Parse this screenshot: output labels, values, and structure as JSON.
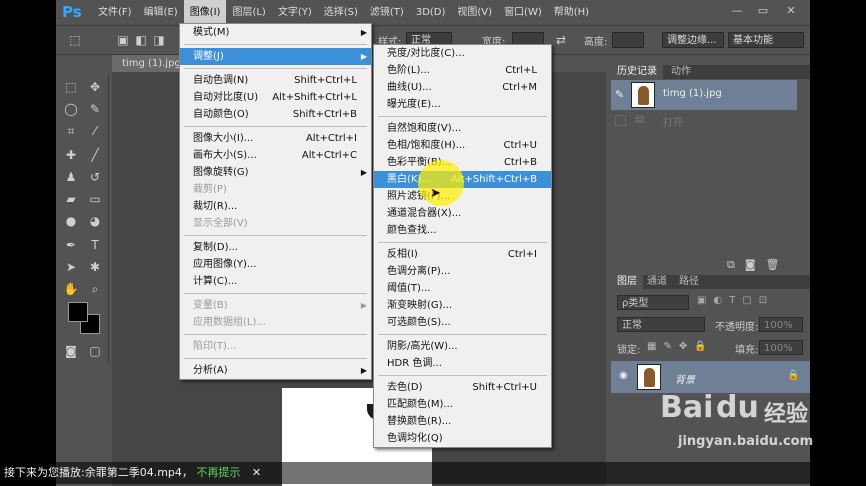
{
  "app": {
    "logo": "Ps"
  },
  "menubar": [
    "文件(F)",
    "编辑(E)",
    "图像(I)",
    "图层(L)",
    "文字(Y)",
    "选择(S)",
    "滤镜(T)",
    "3D(D)",
    "视图(V)",
    "窗口(W)",
    "帮助(H)"
  ],
  "window_controls": {
    "minimize": "—",
    "restore": "▭",
    "close": "✕"
  },
  "options_bar": {
    "style_label": "样式:",
    "style_value": "正常",
    "width_label": "宽度:",
    "height_label": "高度:",
    "refine_button": "调整边缘...",
    "workspace": "基本功能"
  },
  "document_tab": "timg (1).jpg",
  "image_menu": [
    {
      "label": "模式(M)",
      "shortcut": "",
      "submenu": true,
      "disabled": false
    },
    {
      "sep": true
    },
    {
      "label": "调整(J)",
      "shortcut": "",
      "submenu": true,
      "disabled": false,
      "active": true
    },
    {
      "sep": true
    },
    {
      "label": "自动色调(N)",
      "shortcut": "Shift+Ctrl+L",
      "disabled": false
    },
    {
      "label": "自动对比度(U)",
      "shortcut": "Alt+Shift+Ctrl+L",
      "disabled": false
    },
    {
      "label": "自动颜色(O)",
      "shortcut": "Shift+Ctrl+B",
      "disabled": false
    },
    {
      "sep": true
    },
    {
      "label": "图像大小(I)...",
      "shortcut": "Alt+Ctrl+I",
      "disabled": false
    },
    {
      "label": "画布大小(S)...",
      "shortcut": "Alt+Ctrl+C",
      "disabled": false
    },
    {
      "label": "图像旋转(G)",
      "shortcut": "",
      "submenu": true,
      "disabled": false
    },
    {
      "label": "裁剪(P)",
      "shortcut": "",
      "disabled": true
    },
    {
      "label": "裁切(R)...",
      "shortcut": "",
      "disabled": false
    },
    {
      "label": "显示全部(V)",
      "shortcut": "",
      "disabled": true
    },
    {
      "sep": true
    },
    {
      "label": "复制(D)...",
      "shortcut": "",
      "disabled": false
    },
    {
      "label": "应用图像(Y)...",
      "shortcut": "",
      "disabled": false
    },
    {
      "label": "计算(C)...",
      "shortcut": "",
      "disabled": false
    },
    {
      "sep": true
    },
    {
      "label": "变量(B)",
      "shortcut": "",
      "submenu": true,
      "disabled": true
    },
    {
      "label": "应用数据组(L)...",
      "shortcut": "",
      "disabled": true
    },
    {
      "sep": true
    },
    {
      "label": "陷印(T)...",
      "shortcut": "",
      "disabled": true
    },
    {
      "sep": true
    },
    {
      "label": "分析(A)",
      "shortcut": "",
      "submenu": true,
      "disabled": false
    }
  ],
  "adjust_submenu": [
    {
      "label": "亮度/对比度(C)...",
      "shortcut": ""
    },
    {
      "label": "色阶(L)...",
      "shortcut": "Ctrl+L"
    },
    {
      "label": "曲线(U)...",
      "shortcut": "Ctrl+M"
    },
    {
      "label": "曝光度(E)...",
      "shortcut": ""
    },
    {
      "sep": true
    },
    {
      "label": "自然饱和度(V)...",
      "shortcut": ""
    },
    {
      "label": "色相/饱和度(H)...",
      "shortcut": "Ctrl+U"
    },
    {
      "label": "色彩平衡(B)...",
      "shortcut": "Ctrl+B"
    },
    {
      "label": "黑白(K)...",
      "shortcut": "Alt+Shift+Ctrl+B",
      "highlight": true
    },
    {
      "label": "照片滤镜(F)...",
      "shortcut": ""
    },
    {
      "label": "通道混合器(X)...",
      "shortcut": ""
    },
    {
      "label": "颜色查找...",
      "shortcut": ""
    },
    {
      "sep": true
    },
    {
      "label": "反相(I)",
      "shortcut": "Ctrl+I"
    },
    {
      "label": "色调分离(P)...",
      "shortcut": ""
    },
    {
      "label": "阈值(T)...",
      "shortcut": ""
    },
    {
      "label": "渐变映射(G)...",
      "shortcut": ""
    },
    {
      "label": "可选颜色(S)...",
      "shortcut": ""
    },
    {
      "sep": true
    },
    {
      "label": "阴影/高光(W)...",
      "shortcut": ""
    },
    {
      "label": "HDR 色调...",
      "shortcut": ""
    },
    {
      "sep": true
    },
    {
      "label": "去色(D)",
      "shortcut": "Shift+Ctrl+U"
    },
    {
      "label": "匹配颜色(M)...",
      "shortcut": ""
    },
    {
      "label": "替换颜色(R)...",
      "shortcut": ""
    },
    {
      "label": "色调均化(Q)",
      "shortcut": ""
    }
  ],
  "history_panel": {
    "tabs": [
      "历史记录",
      "动作"
    ],
    "items": [
      "timg (1).jpg",
      "打开"
    ]
  },
  "layers_panel": {
    "tabs": [
      "图层",
      "通道",
      "路径"
    ],
    "filter_label": "ρ类型",
    "blend_mode": "正常",
    "opacity_label": "不透明度:",
    "opacity_value": "100%",
    "lock_label": "锁定:",
    "fill_label": "填充:",
    "fill_value": "100%",
    "layer_name": "背景"
  },
  "caption": {
    "text": "接下来为您播放:余罪第二季04.mp4，",
    "link": "不再提示",
    "close": "✕"
  },
  "watermark": {
    "brand": "Bai",
    "paw": "du",
    "cn": "经验",
    "url": "jingyan.baidu.com"
  }
}
